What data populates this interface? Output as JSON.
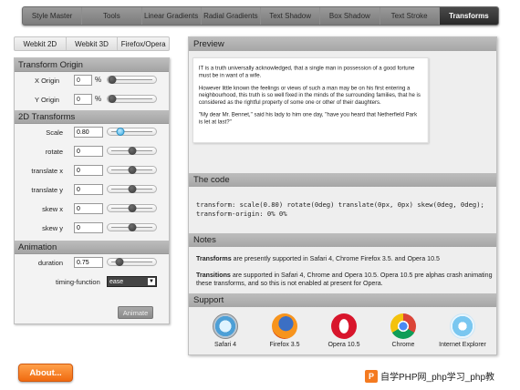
{
  "topnav": {
    "tabs": [
      "Style Master",
      "Tools",
      "Linear Gradients",
      "Radial Gradients",
      "Text Shadow",
      "Box Shadow",
      "Text Stroke",
      "Transforms"
    ]
  },
  "subtabs": [
    "Webkit 2D",
    "Webkit 3D",
    "Firefox/Opera"
  ],
  "left": {
    "origin": {
      "title": "Transform Origin",
      "x_label": "X Origin",
      "x_value": "0",
      "x_unit": "%",
      "y_label": "Y Origin",
      "y_value": "0",
      "y_unit": "%"
    },
    "transforms": {
      "title": "2D Transforms",
      "rows": [
        {
          "label": "Scale",
          "value": "0.80"
        },
        {
          "label": "rotate",
          "value": "0"
        },
        {
          "label": "translate x",
          "value": "0"
        },
        {
          "label": "translate y",
          "value": "0"
        },
        {
          "label": "skew x",
          "value": "0"
        },
        {
          "label": "skew y",
          "value": "0"
        }
      ]
    },
    "animation": {
      "title": "Animation",
      "duration_label": "duration",
      "duration_value": "0.75",
      "timing_label": "timing-function",
      "timing_value": "ease",
      "animate_label": "Animate"
    }
  },
  "right": {
    "preview_title": "Preview",
    "preview_paragraphs": [
      "IT is a truth universally acknowledged, that a single man in possession of a good fortune must be in want of a wife.",
      "However little known the feelings or views of such a man may be on his first entering a neighbourhood, this truth is so well fixed in the minds of the surrounding families, that he is considered as the rightful property of some one or other of their daughters.",
      "\"My dear Mr. Bennet,\" said his lady to him one day, \"have you heard that Netherfield Park is let at last?\""
    ],
    "code_title": "The code",
    "code_text": "transform: scale(0.80) rotate(0deg) translate(0px, 0px) skew(0deg, 0deg); transform-origin: 0% 0%",
    "notes_title": "Notes",
    "notes1_bold": "Transforms",
    "notes1_rest": " are presently supported in Safari 4, Chrome Firefox 3.5. and Opera 10.5",
    "notes2_bold": "Transitions",
    "notes2_rest": " are supported in Safari 4, Chrome and Opera 10.5. Opera 10.5 pre alphas crash animating these transforms, and so this is not enabled at present for Opera.",
    "support_title": "Support",
    "browsers": [
      "Safari 4",
      "Firefox 3.5",
      "Opera 10.5",
      "Chrome",
      "Internet Explorer"
    ]
  },
  "about_label": "About...",
  "watermark": "自学PHP网_php学习_php教"
}
